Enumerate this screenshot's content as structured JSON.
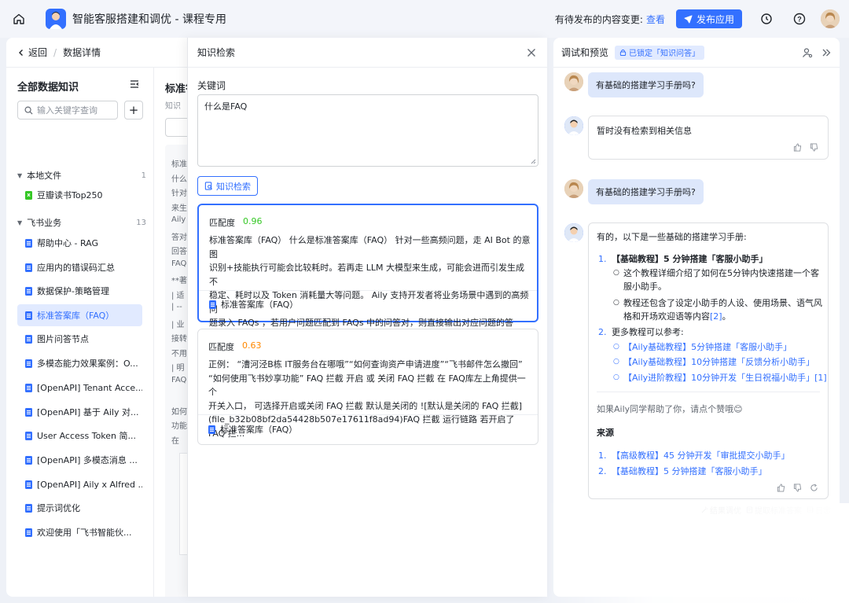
{
  "topbar": {
    "app_title": "智能客服搭建和调优 - 课程专用",
    "pending_text": "有待发布的内容变更:",
    "view_link": "查看",
    "publish_label": "发布应用",
    "icons": [
      "home-icon",
      "history-icon",
      "help-icon"
    ]
  },
  "left_header": {
    "back_label": "返回",
    "separator": "/",
    "crumb": "数据详情"
  },
  "sidebar": {
    "title": "全部数据知识",
    "search_placeholder": "输入关键字查询",
    "add_label": "+",
    "groups": [
      {
        "label": "本地文件",
        "count": "1"
      },
      {
        "label": "飞书业务",
        "count": "13"
      }
    ],
    "local_items": [
      {
        "label": "豆瓣读书Top250",
        "icon": "xls-icon"
      }
    ],
    "feishu_items": [
      {
        "label": "帮助中心 - RAG",
        "icon": "doc-icon"
      },
      {
        "label": "应用内的错误码汇总",
        "icon": "doc-icon"
      },
      {
        "label": "数据保护-策略管理",
        "icon": "doc-icon"
      },
      {
        "label": "标准答案库（FAQ）",
        "icon": "doc-icon",
        "active": true
      },
      {
        "label": "图片问答节点",
        "icon": "doc-icon"
      },
      {
        "label": "多模态能力效果案例：O...",
        "icon": "doc-icon"
      },
      {
        "label": "[OpenAPI] Tenant Acce...",
        "icon": "doc-icon"
      },
      {
        "label": "[OpenAPI] 基于 Aily 对...",
        "icon": "doc-icon"
      },
      {
        "label": "User Access Token 简...",
        "icon": "doc-icon"
      },
      {
        "label": "[OpenAPI] 多模态消息 ...",
        "icon": "doc-icon"
      },
      {
        "label": "[OpenAPI] Aily x Alfred ...",
        "icon": "doc-icon"
      },
      {
        "label": "提示词优化",
        "icon": "doc-icon"
      },
      {
        "label": "欢迎使用「飞书智能伙...",
        "icon": "doc-icon"
      }
    ]
  },
  "middle": {
    "title": "标准答",
    "subtitle": "知识",
    "lines": [
      "标准",
      "什么",
      "针对",
      "来生",
      "Aily",
      "答对",
      "回答",
      "FAQ",
      "**著",
      "| 适",
      "| --",
      "| 业",
      "接转",
      "不用",
      "| 明",
      "FAQ",
      "",
      "如何",
      "功能",
      "在"
    ]
  },
  "modal": {
    "title": "知识检索",
    "keyword_label": "关键词",
    "keyword_value": "什么是FAQ",
    "search_button": "知识检索",
    "results": [
      {
        "score_label": "匹配度",
        "score": "0.96",
        "text_lines": [
          "标准答案库（FAQ） 什么是标准答案库（FAQ） 针对一些高频问题，走 AI Bot 的意图",
          "识别+技能执行可能会比较耗时。若再走 LLM 大模型来生成，可能会进而引发生成不",
          "稳定、耗时以及 Token 消耗量大等问题。 Aily 支持开发者将业务场景中遇到的高频问",
          "题录入 FAQs ，若用户问题匹配到 FAQs 中的问答对，则直接输出对应问题的答案，..."
        ],
        "source": "标准答案库（FAQ）"
      },
      {
        "score_label": "匹配度",
        "score": "0.63",
        "text_lines": [
          "正例： “漕河泾B栋 IT服务台在哪哦”“如何查询资产申请进度”“飞书邮件怎么撤回”",
          "“如何使用飞书妙享功能” FAQ 拦截 开启 或 关闭 FAQ 拦截 在 FAQ库左上角提供一个",
          "开关入口， 可选择开启或关闭 FAQ 拦截 默认是关闭的 ![默认是关闭的 FAQ 拦截]",
          "(file_b32b08bf2da54428b507e17611f8ad94)FAQ 拦截 运行链路 若开启了 FAQ 拦..."
        ],
        "source": "标准答案库（FAQ）"
      }
    ]
  },
  "right": {
    "title": "调试和预览",
    "lock_tag": "已锁定「知识问答」",
    "messages": {
      "q1": "有基础的搭建学习手册吗?",
      "a1": "暂时没有检索到相关信息",
      "q2": "有基础的搭建学习手册吗?",
      "a2_intro": "有的，以下是一些基础的搭建学习手册:",
      "a2_item1_num": "1.",
      "a2_item1_title": "【基础教程】5 分钟搭建「客服小助手」",
      "a2_item1_b1_l1": "这个教程详细介绍了如何在5分钟内快速搭建一个客",
      "a2_item1_b1_l2": "服小助手。",
      "a2_item1_b2_l1": "教程还包含了设定小助手的人设、使用场景、语气风",
      "a2_item1_b2_l2": "格和开场欢迎语等内容",
      "a2_item1_b2_ref": "[2]",
      "a2_item1_b2_end": "。",
      "a2_item2_num": "2.",
      "a2_item2_title": "更多教程可以参考:",
      "a2_link1": "【Aily基础教程】5分钟搭建「客服小助手」",
      "a2_link2": "【Aily基础教程】10分钟搭建「反馈分析小助手」",
      "a2_link3": "【Aily进阶教程】10分钟开发「生日祝福小助手」[1]",
      "a2_outro": "如果Aily同学帮助了你，请点个赞哦😊",
      "sources_title": "来源",
      "src1_num": "1.",
      "src1": "【高级教程】45 分钟开发「审批提交小助手」",
      "src2_num": "2.",
      "src2": "【基础教程】5 分钟搭建「客服小助手」"
    },
    "bottom_actions": [
      "结果调优",
      "提取标准答案",
      "日志"
    ]
  },
  "colors": {
    "accent": "#3370ff",
    "score_high": "#34c724",
    "score_mid": "#ff8800"
  }
}
